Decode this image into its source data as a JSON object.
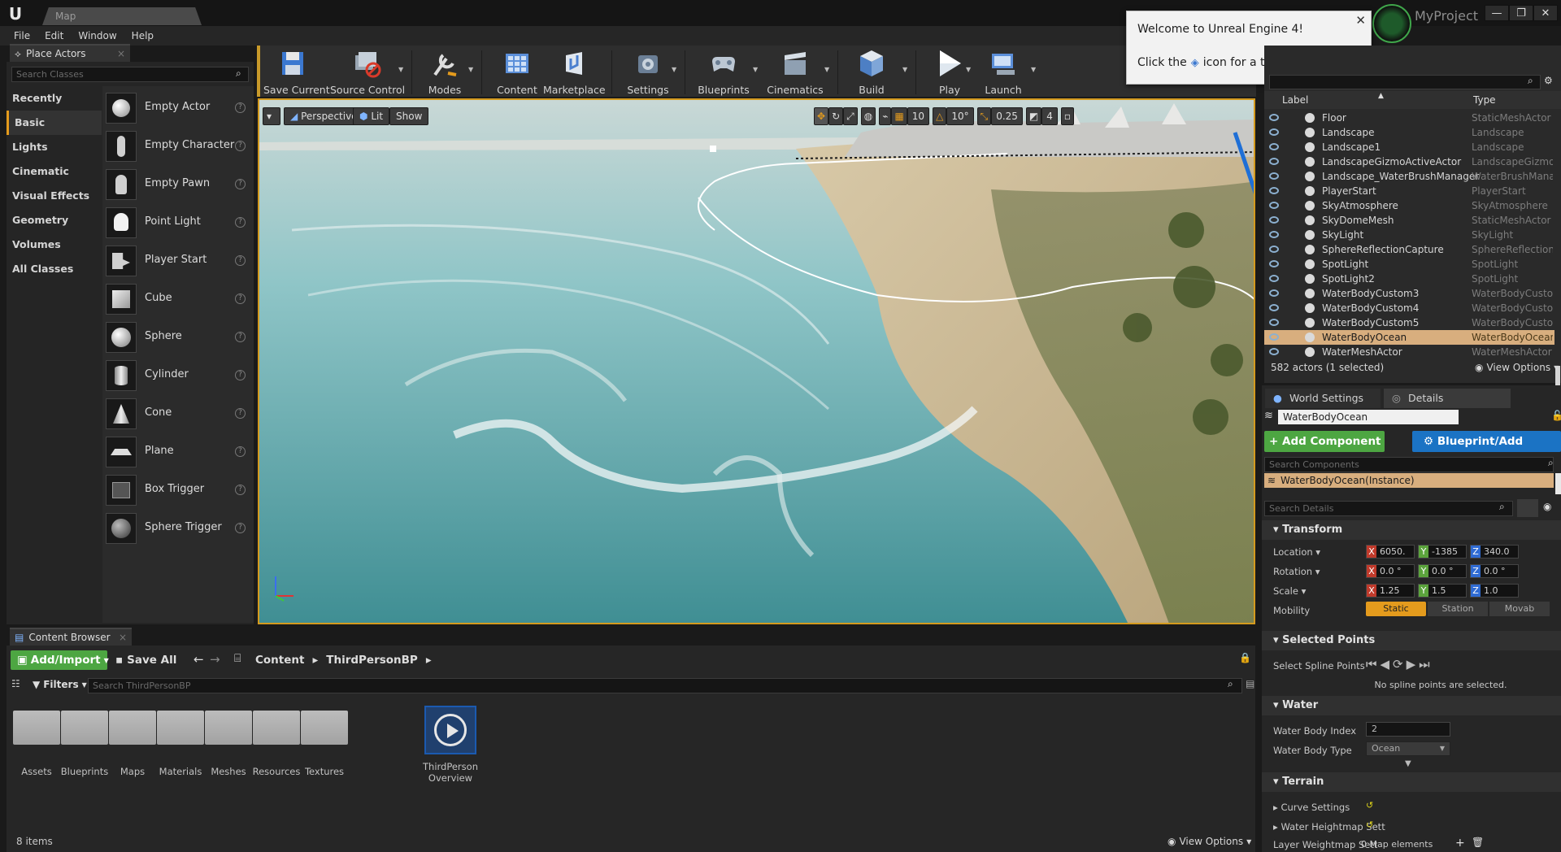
{
  "window": {
    "map_tab": "Map",
    "project_name": "MyProject",
    "minimize": "—",
    "maximize": "❐",
    "close": "✕"
  },
  "menu": [
    "File",
    "Edit",
    "Window",
    "Help"
  ],
  "place_actors": {
    "tab_label": "Place Actors",
    "search_placeholder": "Search Classes",
    "categories": [
      "Recently Placed",
      "Basic",
      "Lights",
      "Cinematic",
      "Visual Effects",
      "Geometry",
      "Volumes",
      "All Classes"
    ],
    "selected_category": "Basic",
    "actors": [
      "Empty Actor",
      "Empty Character",
      "Empty Pawn",
      "Point Light",
      "Player Start",
      "Cube",
      "Sphere",
      "Cylinder",
      "Cone",
      "Plane",
      "Box Trigger",
      "Sphere Trigger"
    ]
  },
  "toolbar": {
    "buttons": [
      "Save Current",
      "Source Control",
      "Modes",
      "Content",
      "Marketplace",
      "Settings",
      "Blueprints",
      "Cinematics",
      "Build",
      "Play",
      "Launch"
    ]
  },
  "viewport": {
    "perspective": "Perspective",
    "lit": "Lit",
    "show": "Show",
    "grid_snap": "10",
    "rot_snap": "10°",
    "scale_snap": "0.25",
    "cam_speed": "4"
  },
  "welcome": {
    "title": "Welcome to Unreal Engine 4!",
    "body_pre": "Click the",
    "body_post": "icon for a tour of the tools."
  },
  "outliner": {
    "header_label": "Label",
    "header_type": "Type",
    "rows": [
      {
        "label": "Floor",
        "type": "StaticMeshActor"
      },
      {
        "label": "Landscape",
        "type": "Landscape"
      },
      {
        "label": "Landscape1",
        "type": "Landscape"
      },
      {
        "label": "LandscapeGizmoActiveActor",
        "type": "LandscapeGizmo"
      },
      {
        "label": "Landscape_WaterBrushManager",
        "type": "WaterBrushMana"
      },
      {
        "label": "PlayerStart",
        "type": "PlayerStart"
      },
      {
        "label": "SkyAtmosphere",
        "type": "SkyAtmosphere"
      },
      {
        "label": "SkyDomeMesh",
        "type": "StaticMeshActor"
      },
      {
        "label": "SkyLight",
        "type": "SkyLight"
      },
      {
        "label": "SphereReflectionCapture",
        "type": "SphereReflection("
      },
      {
        "label": "SpotLight",
        "type": "SpotLight"
      },
      {
        "label": "SpotLight2",
        "type": "SpotLight"
      },
      {
        "label": "WaterBodyCustom3",
        "type": "WaterBodyCustor"
      },
      {
        "label": "WaterBodyCustom4",
        "type": "WaterBodyCustor"
      },
      {
        "label": "WaterBodyCustom5",
        "type": "WaterBodyCustor"
      },
      {
        "label": "WaterBodyOcean",
        "type": "WaterBodyOcean"
      },
      {
        "label": "WaterMeshActor",
        "type": "WaterMeshActor"
      }
    ],
    "selected_row": "WaterBodyOcean",
    "status": "582 actors (1 selected)",
    "view_options": "View Options"
  },
  "details": {
    "tab_world": "World Settings",
    "tab_details": "Details",
    "actor_name": "WaterBodyOcean",
    "add_component": "+ Add Component",
    "blueprint_script": "Blueprint/Add Script",
    "search_components": "Search Components",
    "component_instance": "WaterBodyOcean(Instance)",
    "search_details": "Search Details",
    "transform": {
      "header": "Transform",
      "location_label": "Location",
      "rotation_label": "Rotation",
      "scale_label": "Scale",
      "mobility_label": "Mobility",
      "location": [
        "6050.",
        "-1385",
        "340.0"
      ],
      "rotation": [
        "0.0 °",
        "0.0 °",
        "0.0 °"
      ],
      "scale": [
        "1.25",
        "1.5",
        "1.0"
      ],
      "mobility": [
        "Static",
        "Station",
        "Movab"
      ]
    },
    "selected_points": {
      "header": "Selected Points",
      "label": "Select Spline Points",
      "note": "No spline points are selected."
    },
    "water": {
      "header": "Water",
      "index_label": "Water Body Index",
      "index_value": "2",
      "type_label": "Water Body Type",
      "type_value": "Ocean"
    },
    "terrain": {
      "header": "Terrain",
      "curve": "Curve Settings",
      "heightmap": "Water Heightmap Sett",
      "weightmap": "Layer Weightmap Sett",
      "weightmap_value": "0 Map elements"
    }
  },
  "content_browser": {
    "tab_label": "Content Browser",
    "add_import": "Add/Import",
    "save_all": "Save All",
    "path": [
      "Content",
      "ThirdPersonBP"
    ],
    "filters": "Filters",
    "search_placeholder": "Search ThirdPersonBP",
    "folders": [
      "Assets",
      "Blueprints",
      "Maps",
      "Materials",
      "Meshes",
      "Resources",
      "Textures"
    ],
    "asset": "ThirdPerson Overview",
    "count": "8 items",
    "view_options": "View Options"
  }
}
